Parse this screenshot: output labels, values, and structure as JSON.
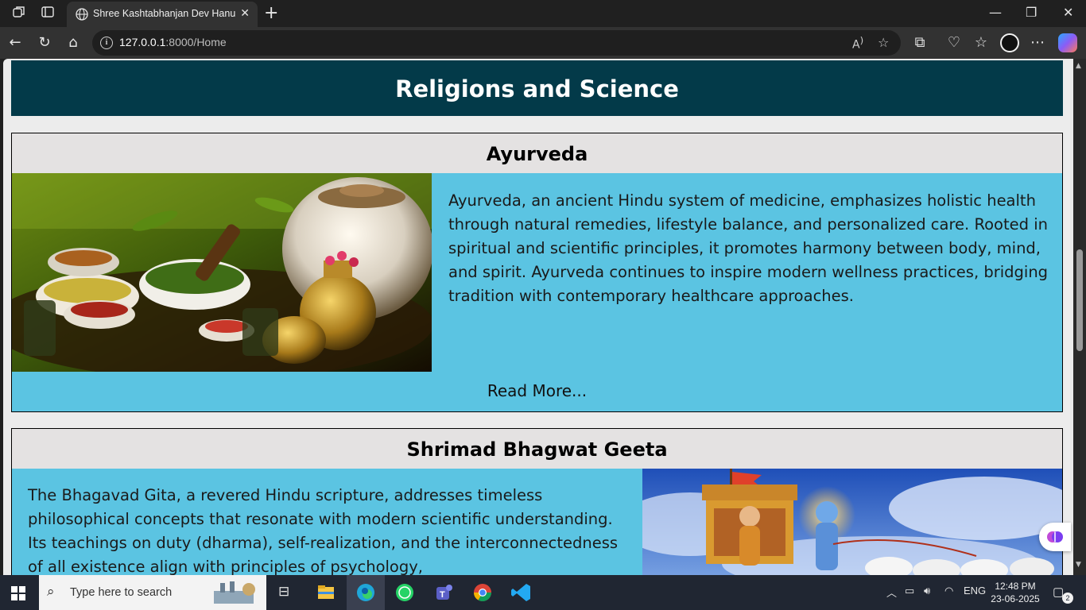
{
  "browser": {
    "tab_title": "Shree Kashtabhanjan Dev Hanuman",
    "url_host": "127.0.0.1",
    "url_rest": ":8000/Home"
  },
  "page": {
    "hero_title": "Religions and Science",
    "cards": [
      {
        "title": "Ayurveda",
        "text": "Ayurveda, an ancient Hindu system of medicine, emphasizes holistic health through natural remedies, lifestyle balance, and personalized care. Rooted in spiritual and scientific principles, it promotes harmony between body, mind, and spirit. Ayurveda continues to inspire modern wellness practices, bridging tradition with contemporary healthcare approaches.",
        "read_more": "Read More..."
      },
      {
        "title": "Shrimad Bhagwat Geeta",
        "text": "The Bhagavad Gita, a revered Hindu scripture, addresses timeless philosophical concepts that resonate with modern scientific understanding. Its teachings on duty (dharma), self-realization, and the interconnectedness of all existence align with principles of psychology,"
      }
    ]
  },
  "taskbar": {
    "search_placeholder": "Type here to search",
    "language": "ENG",
    "time": "12:48 PM",
    "date": "23-06-2025",
    "notification_count": "2"
  },
  "colors": {
    "hero_bg": "#033a49",
    "card_body": "#5bc4e2",
    "card_header": "#e4e2e2"
  }
}
